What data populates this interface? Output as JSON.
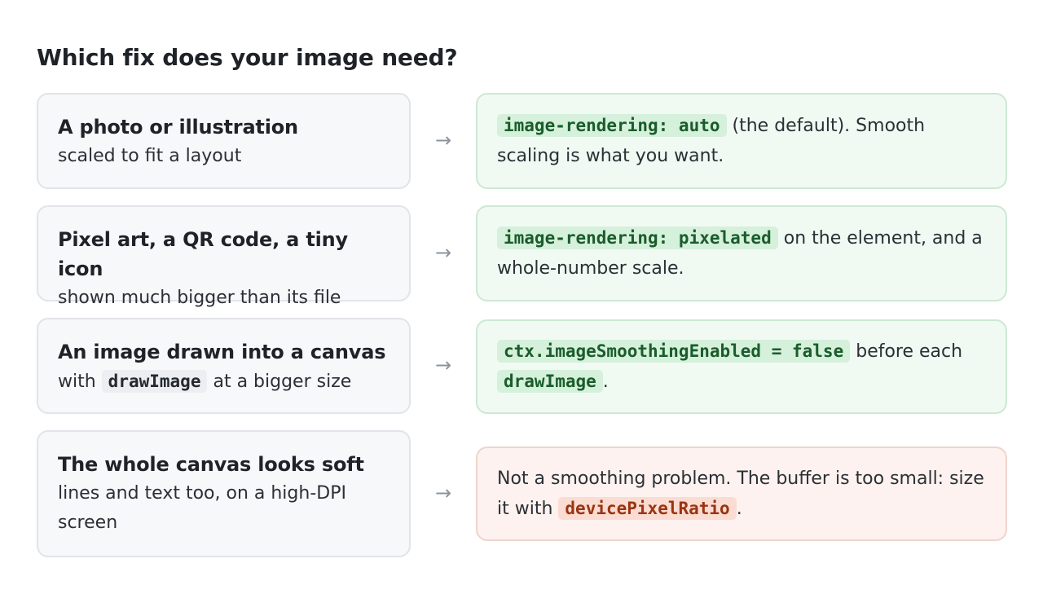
{
  "heading": "Which fix does your image need?",
  "rows": [
    {
      "left_title": "A photo or illustration",
      "left_sub": "scaled to fit a layout",
      "arrow": "→",
      "right_code": "image-rendering: auto",
      "right_text": " (the default). Smooth scaling is what you want."
    },
    {
      "left_title": "Pixel art, a QR code, a tiny icon",
      "left_sub": "shown much bigger than its file",
      "arrow": "→",
      "right_code": "image-rendering: pixelated",
      "right_text": " on the element, and a whole-number scale."
    },
    {
      "left_title": "An image drawn into a canvas",
      "left_sub_pre": "with ",
      "left_sub_code": "drawImage",
      "left_sub_post": " at a bigger size",
      "arrow": "→",
      "right_code": "ctx.imageSmoothingEnabled = false",
      "right_text_mid": " before each ",
      "right_code2": "drawImage",
      "right_text_end": "."
    },
    {
      "left_title": "The whole canvas looks soft",
      "left_sub": "lines and text too, on a high-DPI screen",
      "arrow": "→",
      "right_text_pre": "Not a smoothing problem. The buffer is too small: size it with ",
      "right_code": "devicePixelRatio",
      "right_text_end": "."
    }
  ],
  "colors": {
    "good_bg": "#f0faf2",
    "bad_bg": "#fdf2ef",
    "left_bg": "#f6f8fa"
  }
}
